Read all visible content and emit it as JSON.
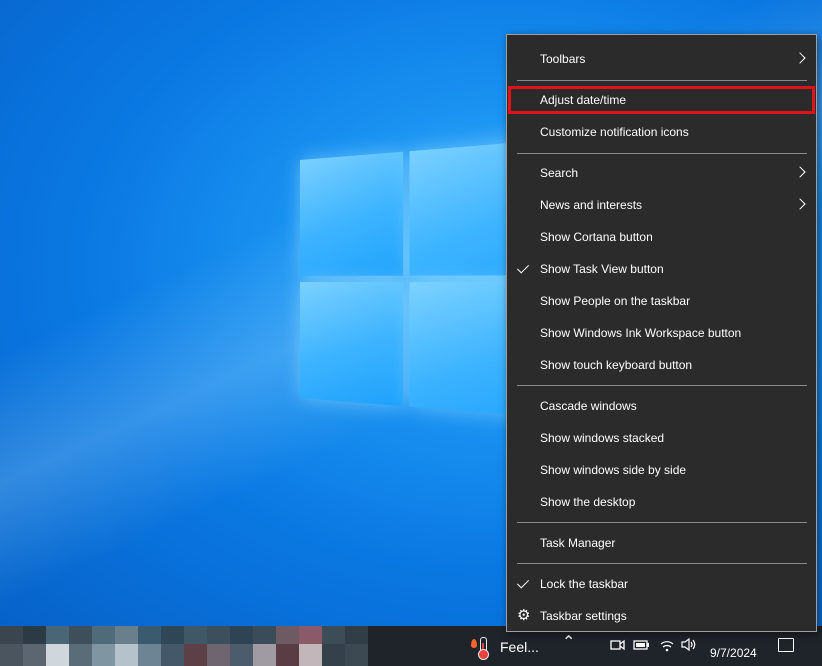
{
  "context_menu": {
    "items": [
      {
        "label": "Toolbars",
        "submenu": true
      },
      {
        "label": "Adjust date/time",
        "highlighted": true
      },
      {
        "label": "Customize notification icons"
      },
      {
        "label": "Search",
        "submenu": true
      },
      {
        "label": "News and interests",
        "submenu": true
      },
      {
        "label": "Show Cortana button"
      },
      {
        "label": "Show Task View button",
        "checked": true
      },
      {
        "label": "Show People on the taskbar"
      },
      {
        "label": "Show Windows Ink Workspace button"
      },
      {
        "label": "Show touch keyboard button"
      },
      {
        "label": "Cascade windows"
      },
      {
        "label": "Show windows stacked"
      },
      {
        "label": "Show windows side by side"
      },
      {
        "label": "Show the desktop"
      },
      {
        "label": "Task Manager"
      },
      {
        "label": "Lock the taskbar",
        "checked": true
      },
      {
        "label": "Taskbar settings",
        "icon": "gear-icon"
      }
    ],
    "highlight_color": "#e0131b"
  },
  "taskbar": {
    "weather_text": "Feel...",
    "weather_icon": "thermometer-icon",
    "tray_icons": [
      "chevron-up-icon",
      "meet-now-icon",
      "battery-icon",
      "wifi-icon",
      "volume-icon"
    ],
    "date": "9/7/2024",
    "notification_icon": "action-center-icon"
  },
  "colors": {
    "menu_background": "#2b2b2b",
    "taskbar_background": "#1f242b",
    "desktop_blue": "#0a78e2"
  }
}
